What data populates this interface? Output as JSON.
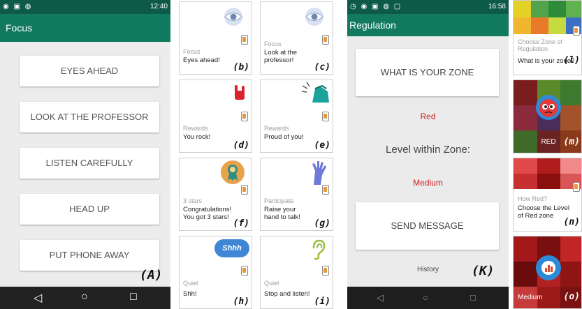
{
  "focus_screen": {
    "status_time": "12:40",
    "title": "Focus",
    "buttons": [
      "EYES AHEAD",
      "LOOK AT THE PROFESSOR",
      "LISTEN CAREFULLY",
      "HEAD UP",
      "PUT PHONE AWAY"
    ],
    "figure_label": "(A)",
    "nav": {
      "back": "◁",
      "home": "○",
      "recent": "□"
    }
  },
  "cards": [
    {
      "category": "Focus",
      "message": "Eyes ahead!",
      "label": "(b)",
      "icon": "eye-icon"
    },
    {
      "category": "Focus",
      "message": "Look at the professor!",
      "label": "(c)",
      "icon": "eye-icon"
    },
    {
      "category": "Rewards",
      "message": "You rock!",
      "label": "(d)",
      "icon": "rock-hand-icon"
    },
    {
      "category": "Rewards",
      "message": "Proud of you!",
      "label": "(e)",
      "icon": "clapping-hands-icon"
    },
    {
      "category": "3 stars",
      "message": "Congratulations! You got 3 stars!",
      "label": "(f)",
      "icon": "medal-icon"
    },
    {
      "category": "Participate",
      "message": "Raise your hand to talk!",
      "label": "(g)",
      "icon": "raised-hand-icon"
    },
    {
      "category": "Quiet",
      "message": "Shh!",
      "label": "(h)",
      "icon": "shhh-cloud-icon",
      "icon_text": "Shhh"
    },
    {
      "category": "Quiet",
      "message": "Stop and listen!",
      "label": "(i)",
      "icon": "ear-icon"
    }
  ],
  "regulation_screen": {
    "status_time": "16:58",
    "title": "Regulation",
    "zone_button": "WHAT IS YOUR ZONE",
    "zone_value": "Red",
    "level_label": "Level within Zone:",
    "level_value": "Medium",
    "send_button": "SEND MESSAGE",
    "history_link": "History",
    "figure_label": "(K)",
    "nav": {
      "back": "◁",
      "home": "○",
      "recent": "□"
    }
  },
  "side_cards": [
    {
      "category": "Choose Zone of Regulation",
      "message": "What is your zone?",
      "label": "(l)"
    },
    {
      "center_text": "RED",
      "label": "(m)",
      "icon": "angry-face-icon"
    },
    {
      "category": "How Red?",
      "message": "Choose the Level of Red zone",
      "label": "(n)"
    },
    {
      "center_text": "Medium",
      "label": "(o)",
      "icon": "bar-chart-icon"
    }
  ],
  "colors": {
    "primary": "#127a5f",
    "status_dark": "#0e5a49",
    "red_text": "#cc1f1f"
  }
}
